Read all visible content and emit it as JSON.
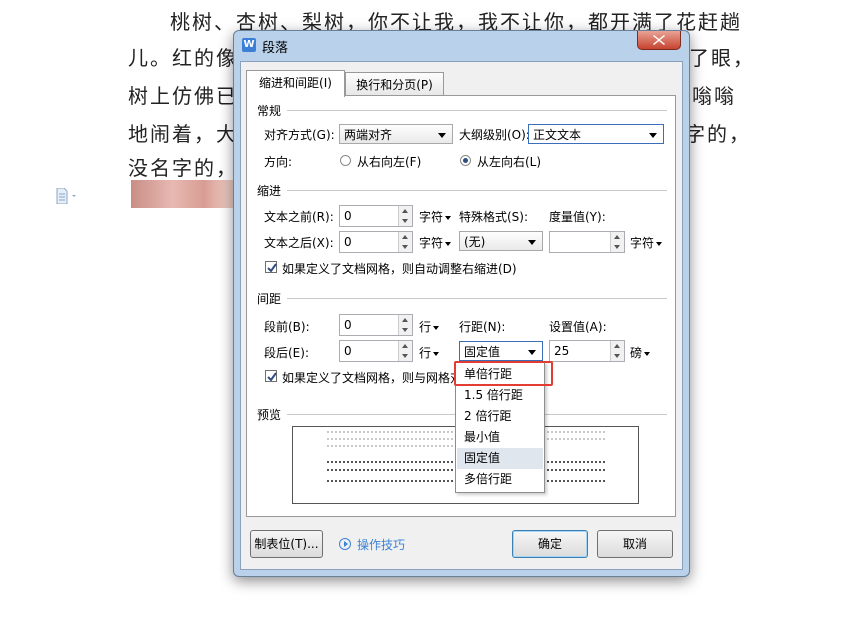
{
  "document": {
    "lines": [
      "桃树、杏树、梨树，你不让我，我不让你，都开满了花赶趟",
      "儿。红的像",
      "了眼，",
      "树上仿佛已",
      "嗡嗡",
      "地闹着，大",
      "字的，",
      "没名字的，"
    ]
  },
  "dialog": {
    "title": "段落",
    "app_logo": "W",
    "tabs": [
      "缩进和间距(I)",
      "换行和分页(P)"
    ],
    "general": {
      "section": "常规",
      "align_label": "对齐方式(G):",
      "align_value": "两端对齐",
      "outline_label": "大纲级别(O):",
      "outline_value": "正文文本",
      "direction_label": "方向:",
      "rtl_label": "从右向左(F)",
      "ltr_label": "从左向右(L)",
      "direction_selected": "ltr"
    },
    "indent": {
      "section": "缩进",
      "before_label": "文本之前(R):",
      "before_value": "0",
      "before_unit": "字符",
      "after_label": "文本之后(X):",
      "after_value": "0",
      "after_unit": "字符",
      "special_label": "特殊格式(S):",
      "special_value": "(无)",
      "measure_label": "度量值(Y):",
      "measure_value": "",
      "measure_unit": "字符",
      "auto_grid_label": "如果定义了文档网格，则自动调整右缩进(D)",
      "auto_grid_checked": true
    },
    "spacing": {
      "section": "间距",
      "before_label": "段前(B):",
      "before_value": "0",
      "before_unit": "行",
      "after_label": "段后(E):",
      "after_value": "0",
      "after_unit": "行",
      "line_label": "行距(N):",
      "line_value": "固定值",
      "set_label": "设置值(A):",
      "set_value": "25",
      "set_unit": "磅",
      "grid_label": "如果定义了文档网格，则与网格对",
      "grid_checked": true
    },
    "preview": {
      "section": "预览"
    },
    "line_spacing_options": [
      "单倍行距",
      "1.5 倍行距",
      "2 倍行距",
      "最小值",
      "固定值",
      "多倍行距"
    ],
    "highlighted_option": "固定值",
    "boxed_option": "单倍行距",
    "buttons": {
      "tabs": "制表位(T)...",
      "tips": "操作技巧",
      "ok": "确定",
      "cancel": "取消"
    }
  },
  "colors": {
    "frame": "#b9d1ea",
    "close": "#c7432f",
    "highlight_box": "#e23c33",
    "link": "#3b82d6"
  },
  "icons": [
    "document-icon",
    "wps-logo-icon",
    "close-icon",
    "check-icon",
    "dropdown-arrow-icon",
    "play-circle-icon"
  ]
}
